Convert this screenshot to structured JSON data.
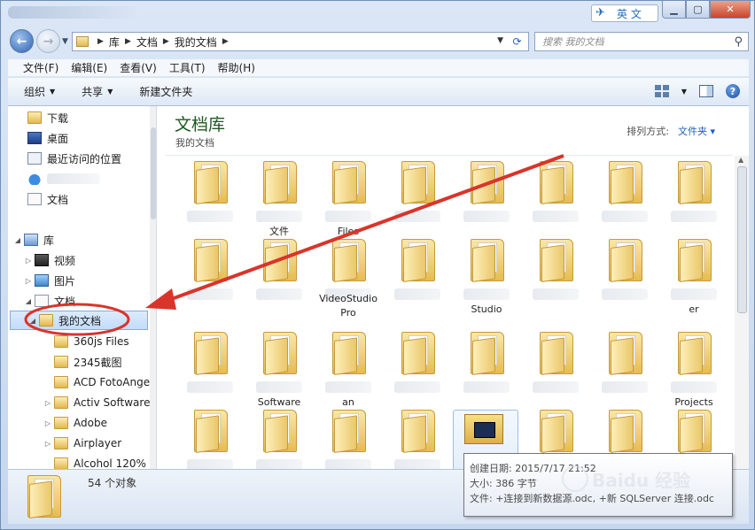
{
  "titlebar": {
    "ime_label": "英 文"
  },
  "address": {
    "crumbs": [
      "库",
      "文档",
      "我的文档"
    ],
    "search_placeholder": "搜索 我的文档"
  },
  "menu": [
    "文件(F)",
    "编辑(E)",
    "查看(V)",
    "工具(T)",
    "帮助(H)"
  ],
  "toolbar": {
    "organize": "组织",
    "share": "共享",
    "new_folder": "新建文件夹"
  },
  "navpane": {
    "downloads": "下载",
    "desktop": "桌面",
    "recent": "最近访问的位置",
    "documents_fav": "文档",
    "library": "库",
    "videos": "视频",
    "pictures": "图片",
    "documents": "文档",
    "my_documents": "我的文档",
    "children": [
      "360js Files",
      "2345截图",
      "ACD FotoAngel",
      "Activ Software",
      "Adobe",
      "Airplayer",
      "Alcohol 120%"
    ]
  },
  "content": {
    "title": "文档库",
    "subtitle": "我的文档",
    "arrange_label": "排列方式:",
    "arrange_value": "文件夹",
    "labels": {
      "r1c2": "文件",
      "r1c3": "Files",
      "r2c3": "VideoStudio Pro",
      "r2c5": "Studio",
      "r2c8": "er",
      "r3c2": "Software",
      "r3c3": "an",
      "r3c8": "Projects"
    }
  },
  "tooltip": {
    "created": "创建日期: 2015/7/17 21:52",
    "size": "大小: 386 字节",
    "files": "文件: +连接到新数据源.odc, +新 SQLServer 连接.odc"
  },
  "details": {
    "count": "54 个对象"
  },
  "watermark": "Baidu 经验",
  "colors": {
    "annotation": "#d9342b",
    "library_title": "#1d5a1f",
    "link": "#1f5fc1"
  }
}
